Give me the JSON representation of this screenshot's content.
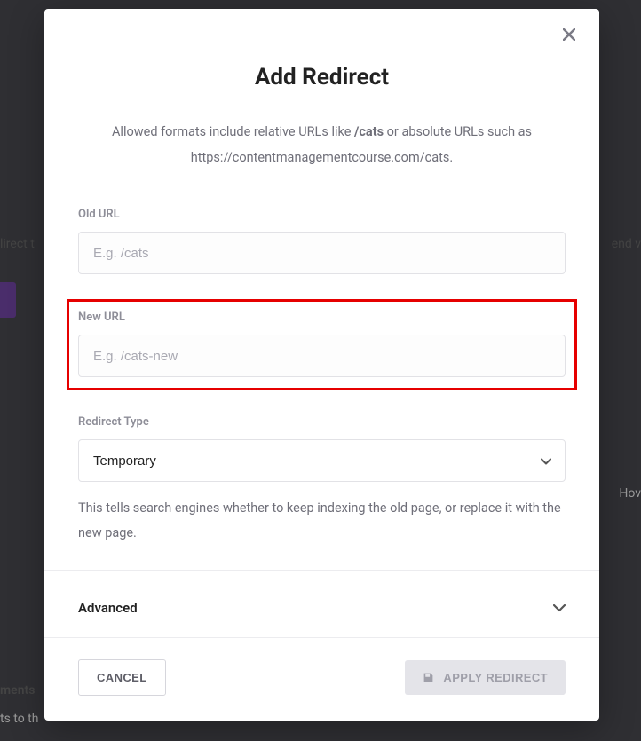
{
  "modal": {
    "title": "Add Redirect",
    "helper_prefix": "Allowed formats include relative URLs like ",
    "helper_bold": "/cats",
    "helper_mid": " or absolute URLs such as ",
    "helper_url": "https://contentmanagementcourse.com/cats",
    "helper_suffix": "."
  },
  "fields": {
    "old_url": {
      "label": "Old URL",
      "placeholder": "E.g. /cats",
      "value": ""
    },
    "new_url": {
      "label": "New URL",
      "placeholder": "E.g. /cats-new",
      "value": ""
    },
    "redirect_type": {
      "label": "Redirect Type",
      "selected": "Temporary",
      "help": "This tells search engines whether to keep indexing the old page, or replace it with the new page."
    }
  },
  "advanced": {
    "label": "Advanced"
  },
  "footer": {
    "cancel": "CANCEL",
    "apply": "APPLY REDIRECT"
  },
  "background": {
    "left1": "lirect t",
    "right1": "end v",
    "right2": "Hov",
    "left2": "ments",
    "left3": "ts to th"
  }
}
